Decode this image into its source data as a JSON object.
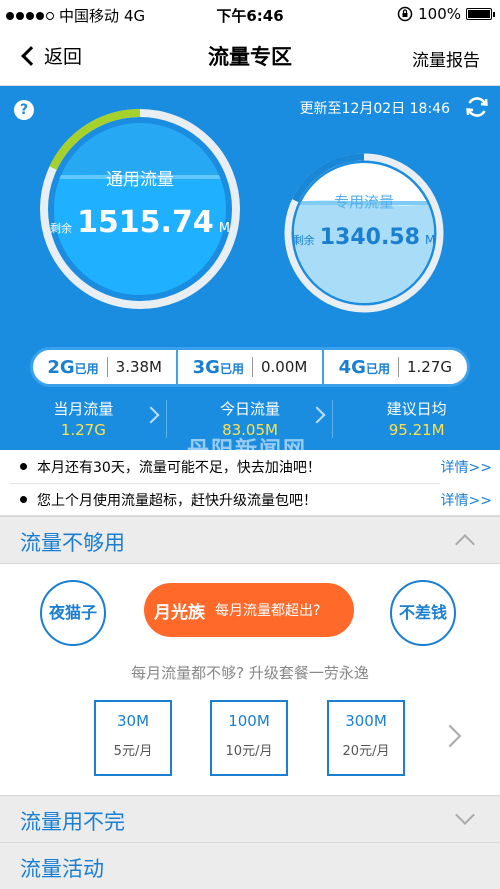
{
  "status_bar": {
    "carrier": "中国移动",
    "network": "4G",
    "time": "下午6:46",
    "battery": "100%",
    "battery_level": 1.0
  },
  "nav": {
    "back_label": "返回",
    "title": "流量专区",
    "report_label": "流量报告"
  },
  "panel": {
    "help_icon": "?",
    "update_text": "更新至12月02日 18:46",
    "general": {
      "label": "通用流量",
      "remain_prefix": "剩余",
      "remain_value": "1515.74",
      "remain_unit": "M",
      "used_fraction": 0.18
    },
    "dedicated": {
      "label": "专用流量",
      "remain_prefix": "剩余",
      "remain_value": "1340.58",
      "remain_unit": "M",
      "used_fraction": 0.18
    },
    "generations": [
      {
        "gen": "2G",
        "used_label": "已用",
        "value": "3.38M"
      },
      {
        "gen": "3G",
        "used_label": "已用",
        "value": "0.00M"
      },
      {
        "gen": "4G",
        "used_label": "已用",
        "value": "1.27G"
      }
    ],
    "stats": [
      {
        "label": "当月流量",
        "value": "1.27G"
      },
      {
        "label": "今日流量",
        "value": "83.05M"
      },
      {
        "label": "建议日均",
        "value": "95.21M"
      }
    ]
  },
  "notices": [
    {
      "text": "本月还有30天，流量可能不足，快去加油吧！",
      "link": "详情>>"
    },
    {
      "text": "您上个月使用流量超标，赶快升级流量包吧！",
      "link": "详情>>"
    }
  ],
  "watermark": "丹阳新闻网",
  "sections": {
    "insufficient": {
      "title": "流量不够用",
      "types": [
        "夜猫子",
        "不差钱"
      ],
      "featured_type": "月光族",
      "featured_desc": "每月流量都超出?",
      "tip": "每月流量都不够? 升级套餐一劳永逸",
      "packages": [
        {
          "size": "30M",
          "price": "5元/月"
        },
        {
          "size": "100M",
          "price": "10元/月"
        },
        {
          "size": "300M",
          "price": "20元/月"
        }
      ]
    },
    "excess": {
      "title": "流量用不完"
    },
    "activity": {
      "title": "流量活动"
    }
  },
  "colors": {
    "panel_blue": "#1a8de0",
    "accent_orange": "#ff6a2b",
    "highlight_yellow": "#ffe14a",
    "arc_green": "#a6d12d"
  }
}
